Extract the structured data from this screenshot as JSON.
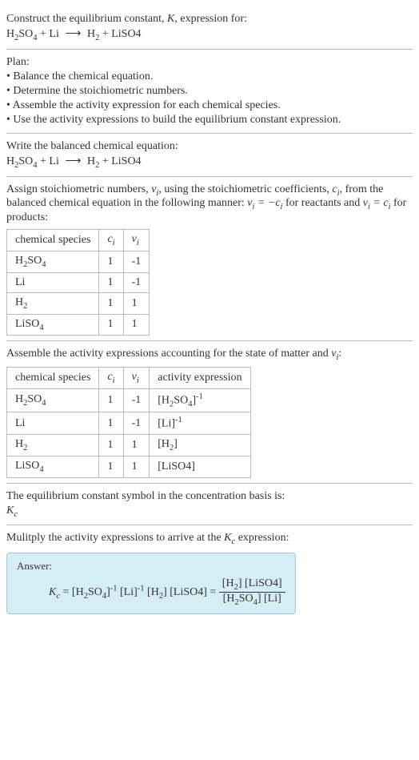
{
  "intro": {
    "prompt_prefix": "Construct the equilibrium constant, ",
    "K": "K",
    "prompt_suffix": ", expression for:",
    "reaction_text": "H₂SO₄ + Li ⟶ H₂ + LiSO4"
  },
  "plan": {
    "heading": "Plan:",
    "items": [
      "Balance the chemical equation.",
      "Determine the stoichiometric numbers.",
      "Assemble the activity expression for each chemical species.",
      "Use the activity expressions to build the equilibrium constant expression."
    ]
  },
  "balanced": {
    "heading": "Write the balanced chemical equation:",
    "reaction_text": "H₂SO₄ + Li ⟶ H₂ + LiSO4"
  },
  "stoich": {
    "intro_a": "Assign stoichiometric numbers, ",
    "nu_i": "νᵢ",
    "intro_b": ", using the stoichiometric coefficients, ",
    "c_i": "cᵢ",
    "intro_c": ", from the balanced chemical equation in the following manner: ",
    "rel_reactants": "νᵢ = −cᵢ",
    "for_reactants": " for reactants and ",
    "rel_products": "νᵢ = cᵢ",
    "for_products": " for products:",
    "headers": [
      "chemical species",
      "cᵢ",
      "νᵢ"
    ],
    "rows": [
      {
        "sp": "H₂SO₄",
        "c": "1",
        "n": "-1"
      },
      {
        "sp": "Li",
        "c": "1",
        "n": "-1"
      },
      {
        "sp": "H₂",
        "c": "1",
        "n": "1"
      },
      {
        "sp": "LiSO₄",
        "c": "1",
        "n": "1"
      }
    ]
  },
  "activity": {
    "intro_a": "Assemble the activity expressions accounting for the state of matter and ",
    "nu_i": "νᵢ",
    "intro_b": ":",
    "headers": [
      "chemical species",
      "cᵢ",
      "νᵢ",
      "activity expression"
    ],
    "rows": [
      {
        "sp": "H₂SO₄",
        "c": "1",
        "n": "-1",
        "a": "[H₂SO₄]⁻¹"
      },
      {
        "sp": "Li",
        "c": "1",
        "n": "-1",
        "a": "[Li]⁻¹"
      },
      {
        "sp": "H₂",
        "c": "1",
        "n": "1",
        "a": "[H₂]"
      },
      {
        "sp": "LiSO₄",
        "c": "1",
        "n": "1",
        "a": "[LiSO4]"
      }
    ]
  },
  "symbol": {
    "line": "The equilibrium constant symbol in the concentration basis is:",
    "Kc": "K꜀"
  },
  "multiply": {
    "line_a": "Mulitply the activity expressions to arrive at the ",
    "Kc": "K꜀",
    "line_b": " expression:"
  },
  "answer": {
    "label": "Answer:",
    "Kc": "K꜀",
    "eq": " = [H₂SO₄]⁻¹ [Li]⁻¹ [H₂] [LiSO4] = ",
    "num": "[H₂] [LiSO4]",
    "den": "[H₂SO₄] [Li]"
  }
}
